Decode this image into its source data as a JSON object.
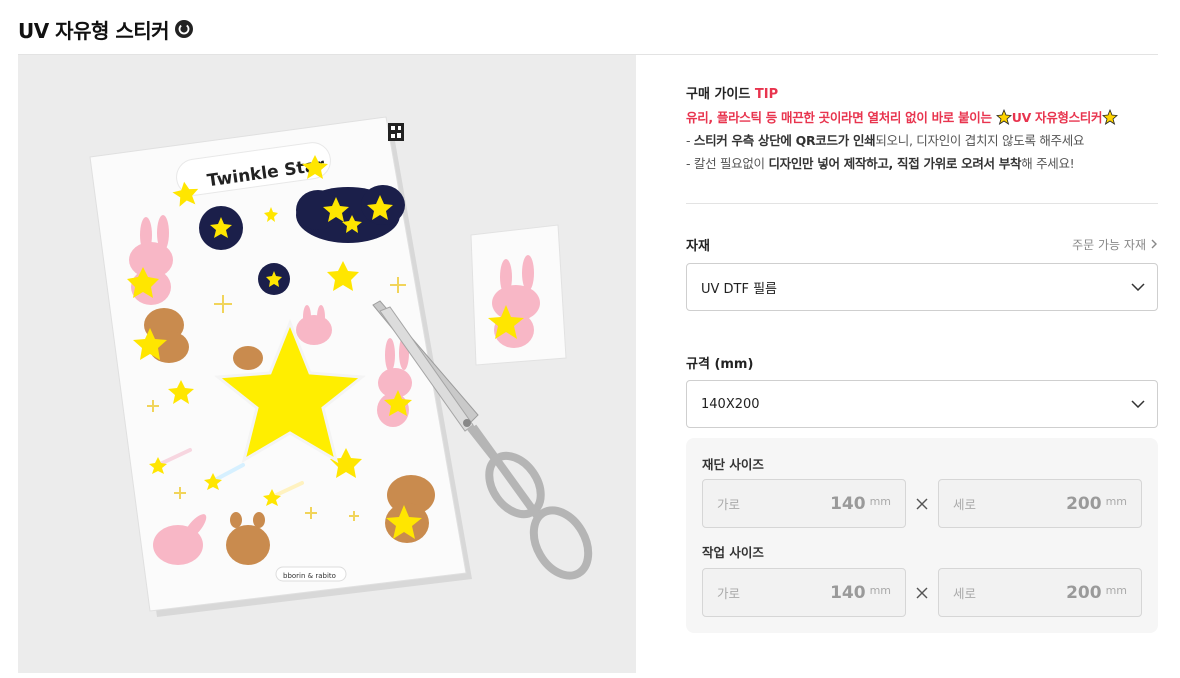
{
  "header": {
    "title": "UV 자유형 스티커",
    "title_icon": "circle-badge-icon"
  },
  "product_image": {
    "sticker_title": "Twinkle Star",
    "credit": "bborin & rabito",
    "alt_subject": "sticker-sheet-with-scissors"
  },
  "guide": {
    "title_prefix": "구매 가이드 ",
    "title_tip": "TIP",
    "line1_a": "유리, 플라스틱 등 매끈한 곳이라면 열처리 없이 바로 붙이는 ",
    "line1_b": "UV 자유형스티커",
    "line2_a": "- ",
    "line2_b": "스티커 우측 상단에 QR코드가 인쇄",
    "line2_c": "되오니, 디자인이 겹치지 않도록 해주세요",
    "line3_a": "- 칼선 필요없이 ",
    "line3_b": "디자인만 넣어 제작하고, 직접 가위로 오려서 부착",
    "line3_c": "해 주세요!"
  },
  "material": {
    "label": "자재",
    "link": "주문 가능 자재",
    "selected": "UV DTF 필름"
  },
  "spec": {
    "label": "규격 (mm)",
    "selected": "140X200"
  },
  "cut_size": {
    "label": "재단 사이즈",
    "width_placeholder": "가로",
    "width_value": "140",
    "height_placeholder": "세로",
    "height_value": "200",
    "unit": "mm"
  },
  "work_size": {
    "label": "작업 사이즈",
    "width_placeholder": "가로",
    "width_value": "140",
    "height_placeholder": "세로",
    "height_value": "200",
    "unit": "mm"
  },
  "colors": {
    "accent_red": "#e8344e",
    "star_yellow": "#ffeb3b",
    "navy": "#1b1f4a"
  }
}
